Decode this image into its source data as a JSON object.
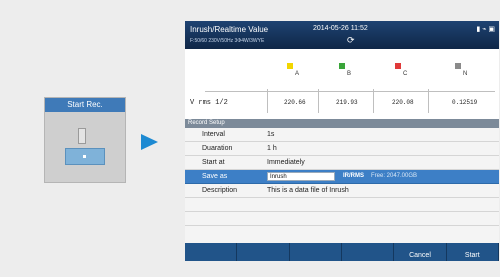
{
  "device": {
    "start_rec_label": "Start Rec."
  },
  "screen": {
    "title": "Inrush/Realtime Value",
    "datetime": "2014-05-26 11:52",
    "sub_info": "F:50/60  230V/50Hz  3Φ4W/3WYE",
    "status_icons": [
      "battery-icon",
      "usb-icon",
      "lock-icon"
    ]
  },
  "table": {
    "phases": [
      {
        "name": "A",
        "color": "#f2d600"
      },
      {
        "name": "B",
        "color": "#3aa53a"
      },
      {
        "name": "C",
        "color": "#e03a3a"
      },
      {
        "name": "N",
        "color": "#8a8a8a"
      }
    ],
    "row_label": "V rms 1/2",
    "values": [
      "220.66",
      "219.93",
      "220.08",
      "0.12519"
    ]
  },
  "dialog": {
    "title": "Record Setup",
    "rows": [
      {
        "label": "Interval",
        "value": "1s"
      },
      {
        "label": "Duaration",
        "value": "1 h"
      },
      {
        "label": "Start at",
        "value": "Immediately"
      }
    ],
    "save_as": {
      "label": "Save as",
      "value": "Inrush",
      "ext": "IR/RMS",
      "free": "Free: 2047.00GB"
    },
    "description": {
      "label": "Description",
      "value": "This is a data file of Inrush"
    },
    "buttons": [
      "",
      "",
      "",
      "",
      "Cancel",
      "Start"
    ]
  },
  "accent": "#3d7fc6"
}
